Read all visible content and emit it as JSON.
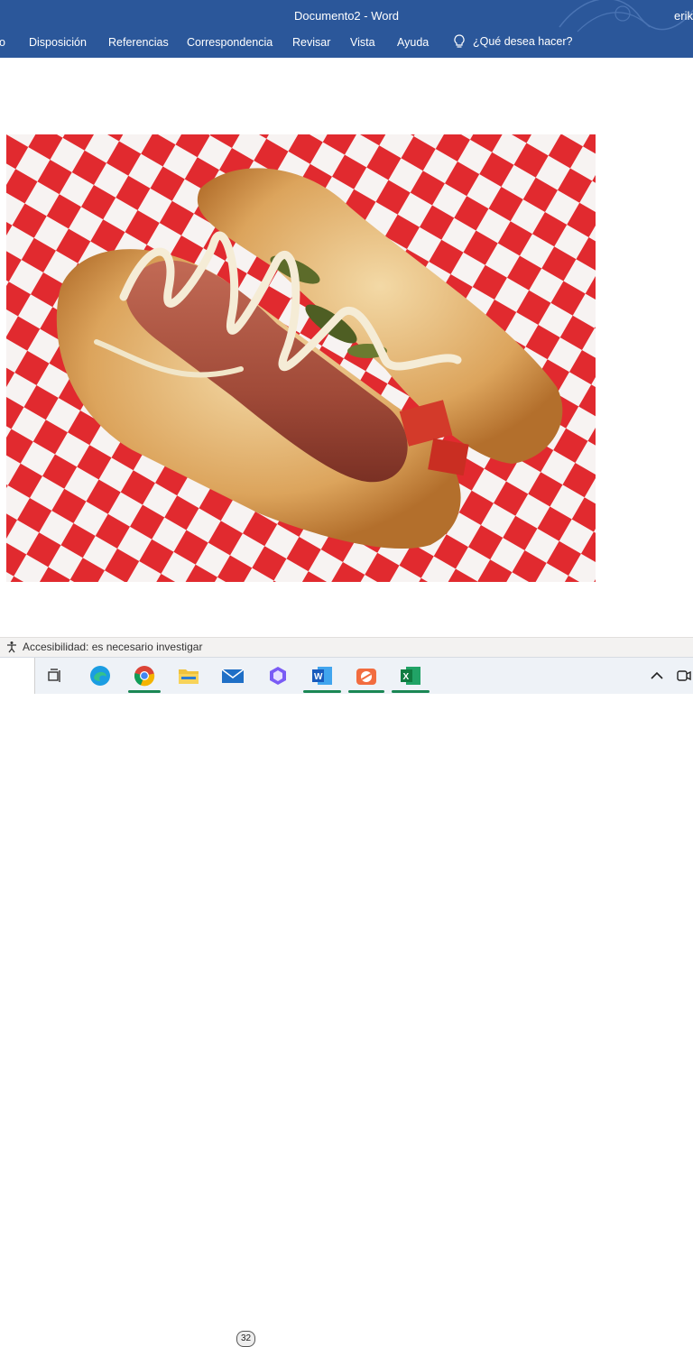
{
  "window": {
    "title": "Documento2  -  Word",
    "user": "erik"
  },
  "ribbon": {
    "tabs": [
      "o",
      "Disposición",
      "Referencias",
      "Correspondencia",
      "Revisar",
      "Vista",
      "Ayuda"
    ],
    "tell_me": "¿Qué desea hacer?"
  },
  "document": {
    "image_description_icon": "hotdog-photo"
  },
  "status_bar": {
    "accessibility": "Accesibilidad: es necesario investigar"
  },
  "taskbar": {
    "mail_badge": "32",
    "apps": [
      "task-view",
      "edge",
      "chrome",
      "file-explorer",
      "mail",
      "copilot",
      "word",
      "snip",
      "excel"
    ]
  },
  "colors": {
    "word_blue": "#2b579a",
    "check_red": "#e12a2f",
    "excel_green": "#1a7343"
  }
}
